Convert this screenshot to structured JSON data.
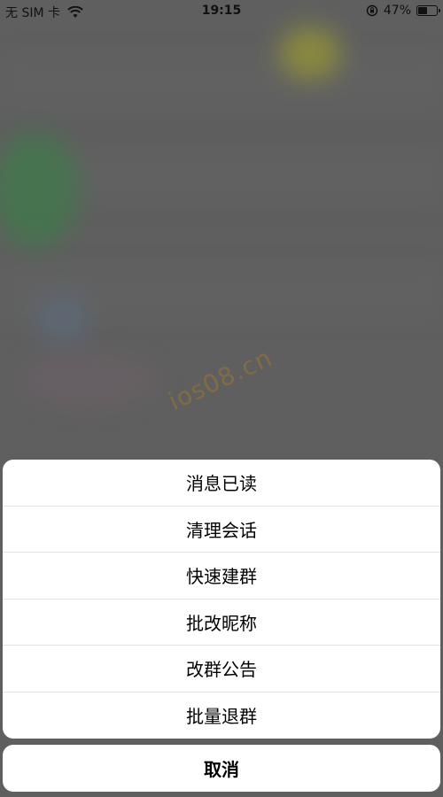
{
  "status_bar": {
    "carrier": "无 SIM 卡",
    "time": "19:15",
    "battery": "47%"
  },
  "watermark": "ios08.cn",
  "action_sheet": {
    "items": [
      "消息已读",
      "清理会话",
      "快速建群",
      "批改昵称",
      "改群公告",
      "批量退群"
    ],
    "cancel": "取消"
  }
}
